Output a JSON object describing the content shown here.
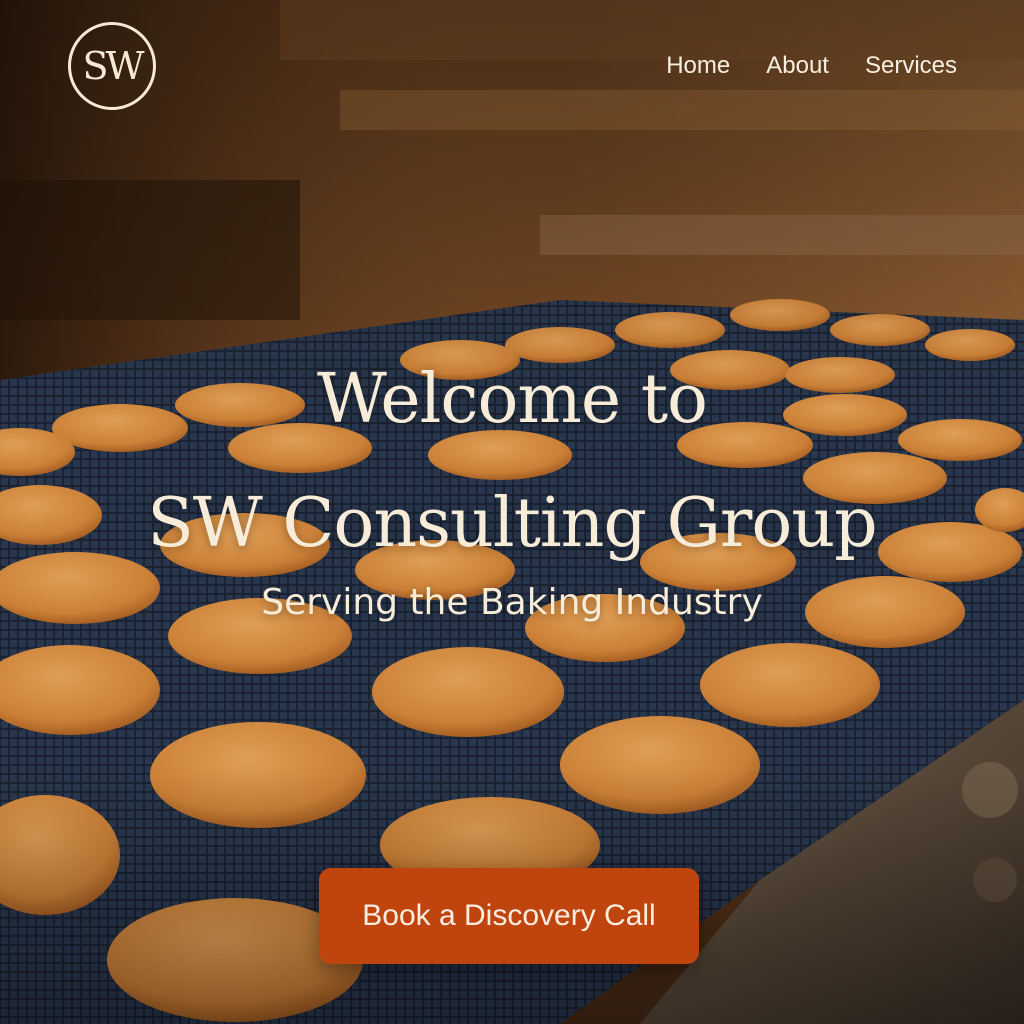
{
  "header": {
    "logo_text": "SW",
    "nav": [
      {
        "label": "Home"
      },
      {
        "label": "About"
      },
      {
        "label": "Services"
      }
    ]
  },
  "hero": {
    "title_line1": "Welcome to",
    "title_line2": "SW Consulting Group",
    "subtitle": "Serving the Baking Industry",
    "cta_label": "Book a Discovery Call"
  },
  "colors": {
    "accent": "#c0440e",
    "text_light": "#f7ecd8",
    "cookie": "#d98a3a",
    "belt": "#1f2838"
  }
}
